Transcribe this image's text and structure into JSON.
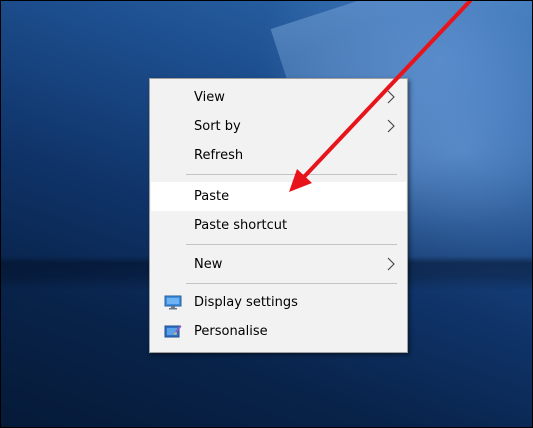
{
  "menu": {
    "items": [
      {
        "label": "View",
        "has_submenu": true
      },
      {
        "label": "Sort by",
        "has_submenu": true
      },
      {
        "label": "Refresh",
        "has_submenu": false
      },
      {
        "label": "Paste",
        "has_submenu": false,
        "highlighted": true
      },
      {
        "label": "Paste shortcut",
        "has_submenu": false
      },
      {
        "label": "New",
        "has_submenu": true
      },
      {
        "label": "Display settings",
        "icon": "display-settings-icon"
      },
      {
        "label": "Personalise",
        "icon": "personalise-icon"
      }
    ]
  },
  "annotation": {
    "color": "#e8141b",
    "target": "Paste"
  },
  "colors": {
    "menu_bg": "#f2f2f2",
    "menu_border": "#a0a0a0",
    "highlight": "#ffffff"
  }
}
